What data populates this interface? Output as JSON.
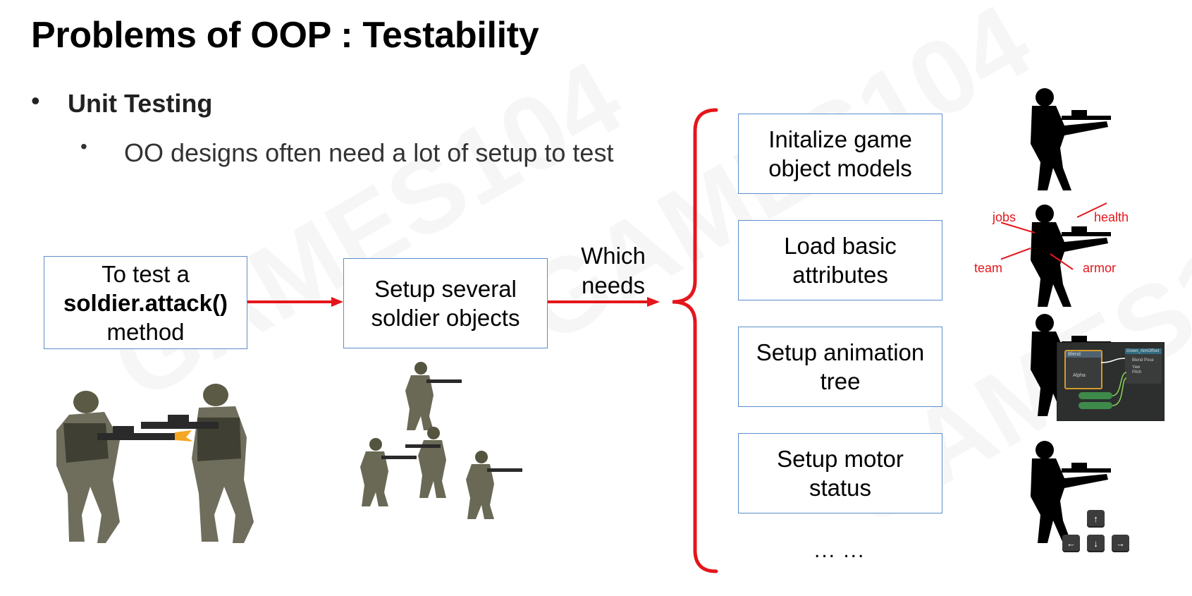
{
  "slide": {
    "title": "Problems of OOP : Testability",
    "bullet_level1": "Unit Testing",
    "bullet_level2": "OO designs often need a lot of setup to test",
    "bullet_char": "•"
  },
  "flow": {
    "box1": {
      "line1": "To test a",
      "line2": "soldier.attack()",
      "line3": "method"
    },
    "box2": {
      "line1": "Setup several",
      "line2": "soldier objects"
    },
    "arrow_label": {
      "line1": "Which",
      "line2": "needs"
    }
  },
  "steps": [
    {
      "line1": "Initalize game",
      "line2": "object models"
    },
    {
      "line1": "Load basic",
      "line2": "attributes"
    },
    {
      "line1": "Setup animation",
      "line2": "tree"
    },
    {
      "line1": "Setup motor",
      "line2": "status"
    }
  ],
  "ellipsis": "... ...",
  "attribute_labels": {
    "jobs": "jobs",
    "health": "health",
    "team": "team",
    "armor": "armor"
  },
  "anim_graph": {
    "node_a": "Blend",
    "node_b": "Green_AimOffset",
    "row1": "Blend Pose",
    "row2": "Yaw",
    "row3": "Pitch",
    "row4": "Alpha"
  },
  "arrow_keys": {
    "up": "↑",
    "left": "←",
    "down": "↓",
    "right": "→"
  },
  "colors": {
    "box_border": "#5b8fcc",
    "accent_red": "#e4161b"
  },
  "watermark": "GAMES104"
}
